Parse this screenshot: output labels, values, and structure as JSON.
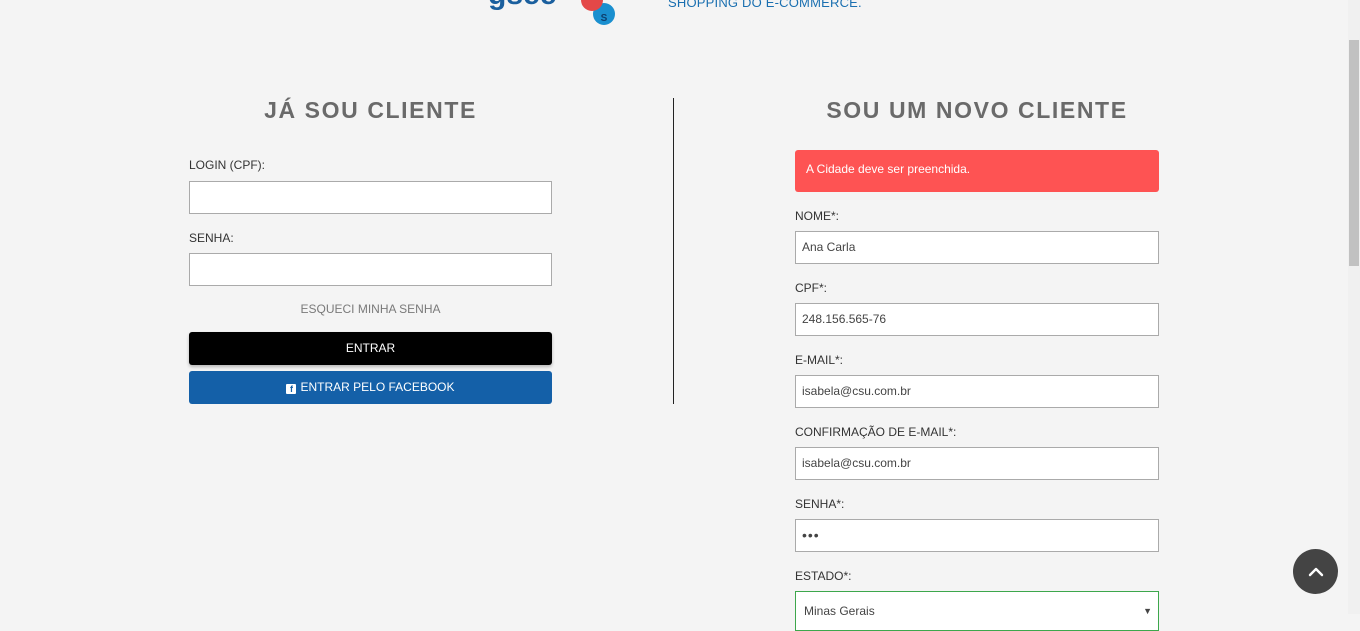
{
  "header": {
    "logo_badge": "S",
    "tagline": "SHOPPING DO E-COMMERCE."
  },
  "login": {
    "title": "JÁ SOU CLIENTE",
    "login_label": "LOGIN (CPF):",
    "login_value": "",
    "password_label": "SENHA:",
    "password_value": "",
    "forgot_link": "ESQUECI MINHA SENHA",
    "enter_button": "ENTRAR",
    "facebook_button": "ENTRAR PELO FACEBOOK",
    "facebook_icon_glyph": "f"
  },
  "register": {
    "title": "SOU UM NOVO CLIENTE",
    "alert": "A Cidade deve ser preenchida.",
    "alert_color": "#fe5353",
    "name_label": "NOME*:",
    "name_value": "Ana Carla",
    "cpf_label": "CPF*:",
    "cpf_value": "248.156.565-76",
    "email_label": "E-MAIL*:",
    "email_value": "isabela@csu.com.br",
    "email_confirm_label": "CONFIRMAÇÃO DE E-MAIL*:",
    "email_confirm_value": "isabela@csu.com.br",
    "password_label": "SENHA*:",
    "password_value": "•••",
    "state_label": "ESTADO*:",
    "state_value": "Minas Gerais",
    "state_arrow": "▼"
  },
  "icons": {
    "back_to_top": "chevron-up-icon",
    "facebook": "facebook-icon"
  },
  "colors": {
    "facebook_blue": "#1460a8",
    "tagline_blue": "#1a6fb0",
    "select_border": "#3da74c"
  }
}
